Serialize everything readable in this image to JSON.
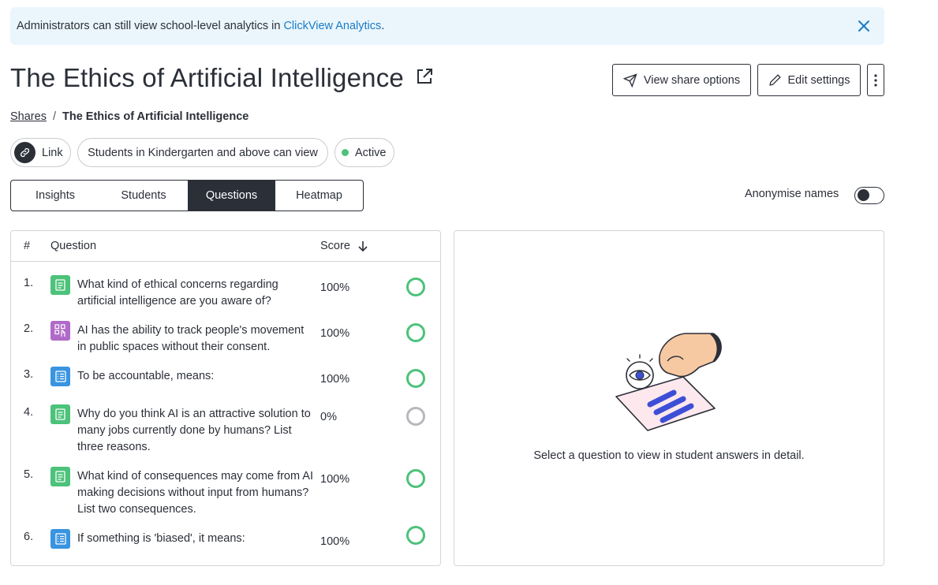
{
  "banner": {
    "text": "Administrators can still view school-level analytics in",
    "link": "ClickView Analytics",
    "end": "."
  },
  "page": {
    "title": "The Ethics of Artificial Intelligence"
  },
  "header_actions": {
    "share_label": "View share options",
    "edit_label": "Edit settings"
  },
  "breadcrumb": {
    "parent": "Shares",
    "separator": "/",
    "current": "The Ethics of Artificial Intelligence"
  },
  "chips": {
    "link": "Link",
    "audience": "Students in Kindergarten and above can view",
    "status": "Active",
    "status_color": "#4cc27a"
  },
  "tabs": [
    {
      "label": "Insights",
      "active": false
    },
    {
      "label": "Students",
      "active": false
    },
    {
      "label": "Questions",
      "active": true
    },
    {
      "label": "Heatmap",
      "active": false
    }
  ],
  "anonymise": {
    "label": "Anonymise names",
    "enabled": false
  },
  "questions_table": {
    "headers": {
      "num": "#",
      "question": "Question",
      "score": "Score"
    },
    "rows": [
      {
        "num": "1.",
        "type_icon": "document-icon",
        "icon_color": "#4cc27a",
        "text": "What kind of ethical concerns regarding artificial intelligence are you aware of?",
        "score": "100%",
        "complete": true
      },
      {
        "num": "2.",
        "type_icon": "drag-drop-icon",
        "icon_color": "#b06ac8",
        "text": "AI has the ability to track people's movement in public spaces without their consent.",
        "score": "100%",
        "complete": true
      },
      {
        "num": "3.",
        "type_icon": "list-icon",
        "icon_color": "#3a94e0",
        "text": "To be accountable, means:",
        "score": "100%",
        "complete": true
      },
      {
        "num": "4.",
        "type_icon": "document-icon",
        "icon_color": "#4cc27a",
        "text": "Why do you think AI is an attractive solution to many jobs currently done by humans? List three reasons.",
        "score": "0%",
        "complete": false
      },
      {
        "num": "5.",
        "type_icon": "document-icon",
        "icon_color": "#4cc27a",
        "text": "What kind of consequences may come from AI making decisions without input from humans? List two consequences.",
        "score": "100%",
        "complete": true
      },
      {
        "num": "6.",
        "type_icon": "list-icon",
        "icon_color": "#3a94e0",
        "text": "If something is 'biased', it means:",
        "score": "100%",
        "complete": true
      }
    ]
  },
  "detail": {
    "message": "Select a question to view in student answers in detail."
  }
}
